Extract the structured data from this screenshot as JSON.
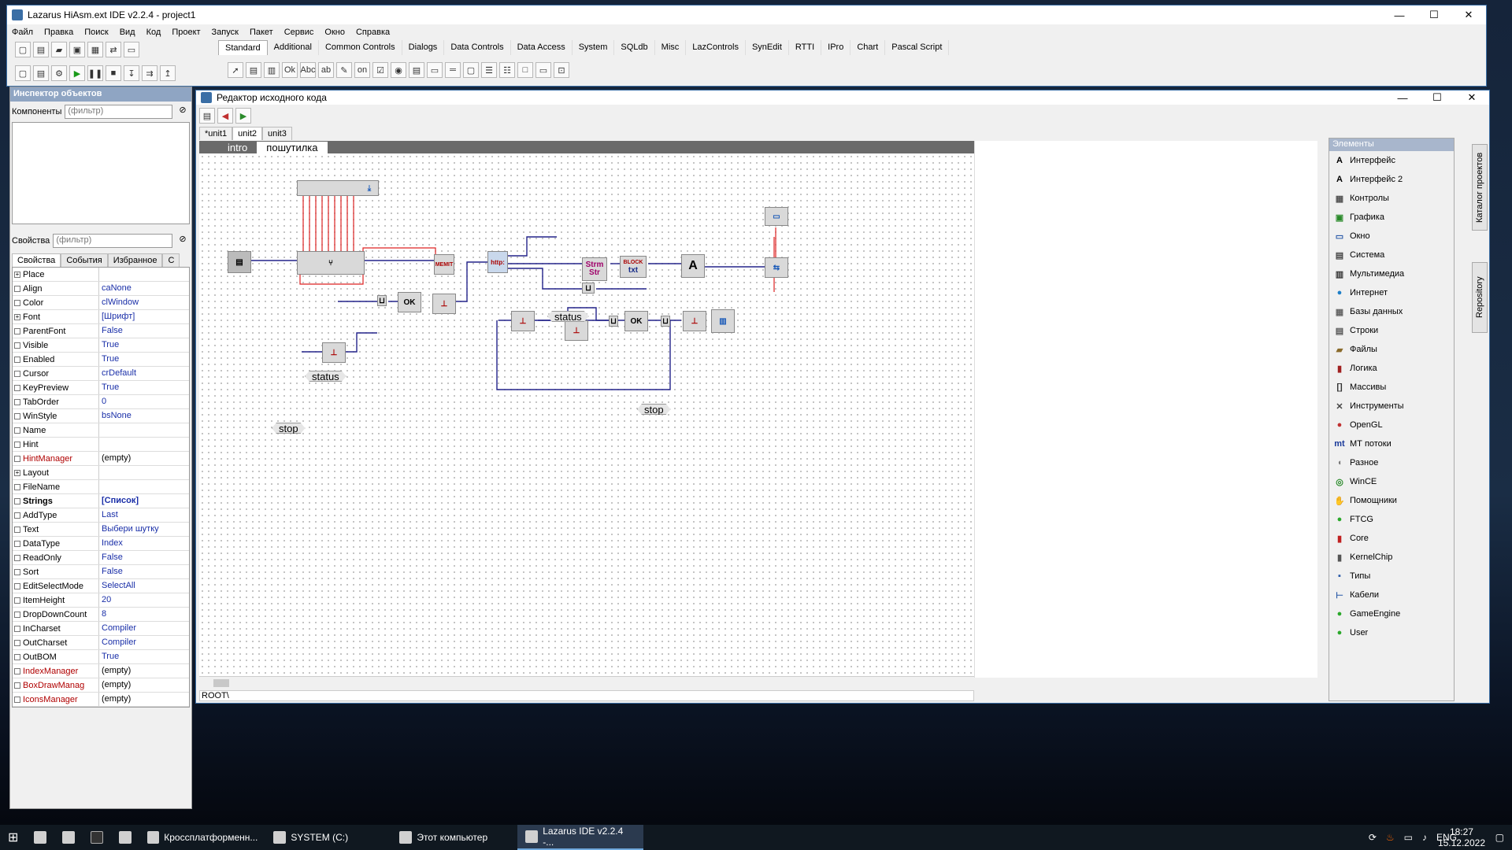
{
  "main": {
    "title": "Lazarus HiAsm.ext IDE v2.2.4 - project1",
    "menu": [
      "Файл",
      "Правка",
      "Поиск",
      "Вид",
      "Код",
      "Проект",
      "Запуск",
      "Пакет",
      "Сервис",
      "Окно",
      "Справка"
    ],
    "palette_tabs": [
      "Standard",
      "Additional",
      "Common Controls",
      "Dialogs",
      "Data Controls",
      "Data Access",
      "System",
      "SQLdb",
      "Misc",
      "LazControls",
      "SynEdit",
      "RTTI",
      "IPro",
      "Chart",
      "Pascal Script"
    ]
  },
  "inspector": {
    "title": "Инспектор объектов",
    "components_label": "Компоненты",
    "filter_placeholder": "(фильтр)",
    "props_label": "Свойства",
    "tabs": [
      "Свойства",
      "События",
      "Избранное",
      "С"
    ],
    "rows": [
      {
        "n": "Place",
        "v": "",
        "exp": "+"
      },
      {
        "n": "Align",
        "v": "caNone"
      },
      {
        "n": "Color",
        "v": "clWindow"
      },
      {
        "n": "Font",
        "v": "[Шрифт]",
        "exp": "+"
      },
      {
        "n": "ParentFont",
        "v": "False"
      },
      {
        "n": "Visible",
        "v": "True"
      },
      {
        "n": "Enabled",
        "v": "True"
      },
      {
        "n": "Cursor",
        "v": "crDefault"
      },
      {
        "n": "KeyPreview",
        "v": "True"
      },
      {
        "n": "TabOrder",
        "v": "0"
      },
      {
        "n": "WinStyle",
        "v": "bsNone"
      },
      {
        "n": "Name",
        "v": ""
      },
      {
        "n": "Hint",
        "v": ""
      },
      {
        "n": "HintManager",
        "v": "(empty)",
        "style": "red"
      },
      {
        "n": "Layout",
        "v": "",
        "exp": "+"
      },
      {
        "n": "FileName",
        "v": ""
      },
      {
        "n": "Strings",
        "v": "[Список]",
        "style": "bold"
      },
      {
        "n": "AddType",
        "v": "Last"
      },
      {
        "n": "Text",
        "v": "Выбери шутку"
      },
      {
        "n": "DataType",
        "v": "Index"
      },
      {
        "n": "ReadOnly",
        "v": "False"
      },
      {
        "n": "Sort",
        "v": "False"
      },
      {
        "n": "EditSelectMode",
        "v": "SelectAll"
      },
      {
        "n": "ItemHeight",
        "v": "20"
      },
      {
        "n": "DropDownCount",
        "v": "8"
      },
      {
        "n": "InCharset",
        "v": "Compiler"
      },
      {
        "n": "OutCharset",
        "v": "Compiler"
      },
      {
        "n": "OutBOM",
        "v": "True"
      },
      {
        "n": "IndexManager",
        "v": "(empty)",
        "style": "red"
      },
      {
        "n": "BoxDrawManag",
        "v": "(empty)",
        "style": "red"
      },
      {
        "n": "IconsManager",
        "v": "(empty)",
        "style": "red"
      }
    ]
  },
  "editor": {
    "title": "Редактор исходного кода",
    "file_tabs": [
      "*unit1",
      "unit2",
      "unit3"
    ],
    "sub_tabs": [
      "intro",
      "пошутилка"
    ],
    "status_path": "ROOT\\",
    "canvas_labels": {
      "status1": "status",
      "status2": "status",
      "stop1": "stop",
      "stop2": "stop",
      "http": "http:",
      "strm_top": "Strm",
      "strm_bot": "Str",
      "block_top": "BLOCK",
      "block_bot": "txt",
      "a": "A",
      "memit": "MEMIT",
      "ok": "OK"
    }
  },
  "elements": {
    "title": "Элементы",
    "items": [
      {
        "name": "Интерфейс",
        "icon": "A",
        "color": "#000"
      },
      {
        "name": "Интерфейс 2",
        "icon": "A",
        "color": "#000"
      },
      {
        "name": "Контролы",
        "icon": "▦",
        "color": "#555"
      },
      {
        "name": "Графика",
        "icon": "▣",
        "color": "#2a8a2a"
      },
      {
        "name": "Окно",
        "icon": "▭",
        "color": "#2a5aa8"
      },
      {
        "name": "Система",
        "icon": "▤",
        "color": "#444"
      },
      {
        "name": "Мультимедиа",
        "icon": "▥",
        "color": "#333"
      },
      {
        "name": "Интернет",
        "icon": "●",
        "color": "#1e7fc8"
      },
      {
        "name": "Базы данных",
        "icon": "▦",
        "color": "#666"
      },
      {
        "name": "Строки",
        "icon": "▤",
        "color": "#555"
      },
      {
        "name": "Файлы",
        "icon": "▰",
        "color": "#8a6a2a"
      },
      {
        "name": "Логика",
        "icon": "▮",
        "color": "#a02020"
      },
      {
        "name": "Массивы",
        "icon": "[]",
        "color": "#333"
      },
      {
        "name": "Инструменты",
        "icon": "✕",
        "color": "#444"
      },
      {
        "name": "OpenGL",
        "icon": "●",
        "color": "#c03030"
      },
      {
        "name": "МТ потоки",
        "icon": "mt",
        "color": "#1a3a9a"
      },
      {
        "name": "Разное",
        "icon": "◖",
        "color": "#777"
      },
      {
        "name": "WinCE",
        "icon": "◎",
        "color": "#2a8a2a"
      },
      {
        "name": "Помощники",
        "icon": "✋",
        "color": "#444"
      },
      {
        "name": "FTCG",
        "icon": "●",
        "color": "#2aa82a"
      },
      {
        "name": "Core",
        "icon": "▮",
        "color": "#c02020"
      },
      {
        "name": "KernelChip",
        "icon": "▮",
        "color": "#555"
      },
      {
        "name": "Типы",
        "icon": "▪",
        "color": "#2a5aa8"
      },
      {
        "name": "Кабели",
        "icon": "⊢",
        "color": "#2a5aa8"
      },
      {
        "name": "GameEngine",
        "icon": "●",
        "color": "#2aa82a"
      },
      {
        "name": "User",
        "icon": "●",
        "color": "#2aa82a"
      }
    ],
    "vtabs": [
      "Каталог проектов",
      "Repository"
    ]
  },
  "taskbar": {
    "items": [
      {
        "label": "Кроссплатформенн...",
        "active": false
      },
      {
        "label": "SYSTEM (C:)",
        "active": false
      },
      {
        "label": "Этот компьютер",
        "active": false
      },
      {
        "label": "Lazarus IDE v2.2.4 -...",
        "active": true
      }
    ],
    "lang": "ENG",
    "time": "18:27",
    "date": "15.12.2022"
  }
}
